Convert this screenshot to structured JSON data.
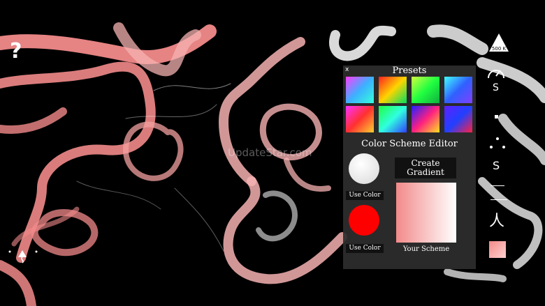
{
  "canvas": {
    "stroke_colors": [
      "#f28a8a",
      "#f6b2b2",
      "#ffffff"
    ]
  },
  "help": {
    "label": "?"
  },
  "watermark": {
    "text": "UpdateStar.com"
  },
  "panel": {
    "close_label": "x",
    "presets_title": "Presets",
    "color_scheme_editor_title": "Color Scheme Editor",
    "use_color_1": "Use Color",
    "use_color_2": "Use Color",
    "create_gradient": "Create\nGradient",
    "your_scheme": "Your Scheme",
    "color_1": "#ffffff",
    "color_2": "#ff0000"
  },
  "side_toolbar": {
    "speed_label": "500 K",
    "stroke_icon": "S",
    "s_label": "S",
    "person_icon": "人"
  }
}
